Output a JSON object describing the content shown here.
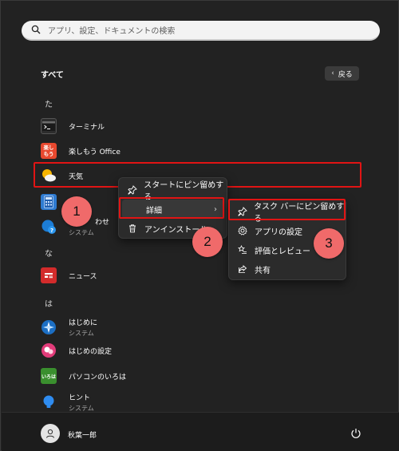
{
  "search": {
    "placeholder": "アプリ、設定、ドキュメントの検索"
  },
  "header": {
    "all_label": "すべて",
    "back_label": "戻る"
  },
  "list": {
    "letter_ta": "た",
    "terminal": {
      "name": "ターミナル"
    },
    "tanoshimou": {
      "name": "楽しもう Office",
      "icon_text": "楽し もう"
    },
    "tenki": {
      "name": "天気"
    },
    "calc": {
      "name": ""
    },
    "tips": {
      "name_fragment": "わせ",
      "sub": "システム"
    },
    "letter_na": "な",
    "news": {
      "name": "ニュース"
    },
    "letter_ha": "は",
    "hajimeni": {
      "name": "はじめに",
      "sub": "システム"
    },
    "hajimeni_settei": {
      "name": "はじめの設定"
    },
    "pc_iroha": {
      "name": "パソコンのいろは",
      "icon_text": "いろは"
    },
    "hint": {
      "name": "ヒント",
      "sub": "システム"
    }
  },
  "menu1": {
    "pin_start": "スタートにピン留めする",
    "details": "詳細",
    "uninstall": "アンインストール"
  },
  "menu2": {
    "pin_taskbar": "タスク バーにピン留めする",
    "app_settings": "アプリの設定",
    "rate_review": "評価とレビュー",
    "share": "共有"
  },
  "callouts": {
    "one": "1",
    "two": "2",
    "three": "3"
  },
  "footer": {
    "user_name": "秋葉一郎"
  },
  "colors": {
    "highlight": "#e11414",
    "callout": "#f06a6a",
    "background": "#222222"
  }
}
